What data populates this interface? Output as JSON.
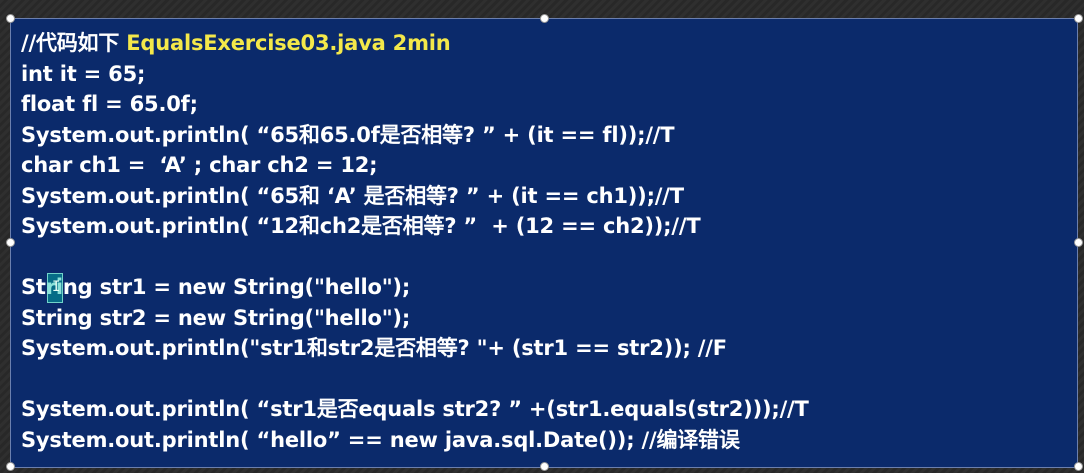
{
  "slide": {
    "line1_prefix": "//代码如下 ",
    "line1_highlight": "EqualsExercise03.java 2min",
    "line2": "int it = 65;",
    "line3": "float fl = 65.0f;",
    "line4": "System.out.println( “65和65.0f是否相等? ” + (it == fl));//T",
    "line5": "char ch1 =  ‘A’ ; char ch2 = 12;",
    "line6": "System.out.println( “65和 ‘A’ 是否相等? ” + (it == ch1));//T",
    "line7": "System.out.println( “12和ch2是否相等? ”  + (12 == ch2));//T",
    "line9": "String str1 = new String(\"hello\");",
    "line10": "String str2 = new String(\"hello\");",
    "line11": "System.out.println(\"str1和str2是否相等? \"+ (str1 == str2)); //F",
    "line13": "System.out.println( “str1是否equals str2? ” +(str1.equals(str2)));//T",
    "line14": "System.out.println( “hello” == new java.sql.Date()); //编译错误"
  },
  "colors": {
    "panel_background": "#0b2a6b",
    "code_text": "#ffffff",
    "highlight_text": "#f4e84a"
  },
  "icons": {
    "cursor": "text-cursor-ibeam-icon",
    "handles": "selection-handle-icon"
  }
}
